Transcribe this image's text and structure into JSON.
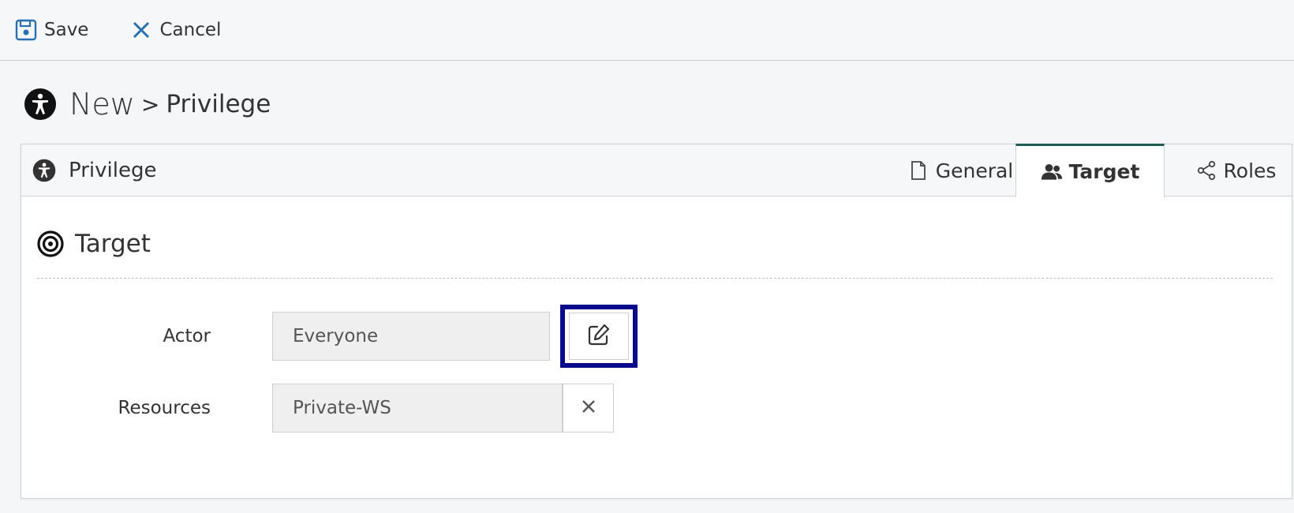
{
  "toolbar": {
    "save_label": "Save",
    "cancel_label": "Cancel",
    "save_icon": "floppy-disk-icon",
    "cancel_icon": "close-x-icon"
  },
  "page": {
    "title_new": "New",
    "title_separator": ">",
    "title_entity": "Privilege",
    "title_icon": "accessibility-icon"
  },
  "panel": {
    "header_title": "Privilege",
    "tabs": [
      {
        "label": "General",
        "icon": "document-icon",
        "active": false
      },
      {
        "label": "Target",
        "icon": "users-icon",
        "active": true
      },
      {
        "label": "Roles",
        "icon": "share-nodes-icon",
        "active": false
      }
    ]
  },
  "section": {
    "title": "Target",
    "icon": "bullseye-icon"
  },
  "form": {
    "actor_label": "Actor",
    "actor_value": "Everyone",
    "resources_label": "Resources",
    "resources_value": "Private-WS"
  },
  "colors": {
    "active_tab_accent": "#1f5c55",
    "highlight_border": "#0a0a8c",
    "icon_blue": "#2a6fb0"
  }
}
